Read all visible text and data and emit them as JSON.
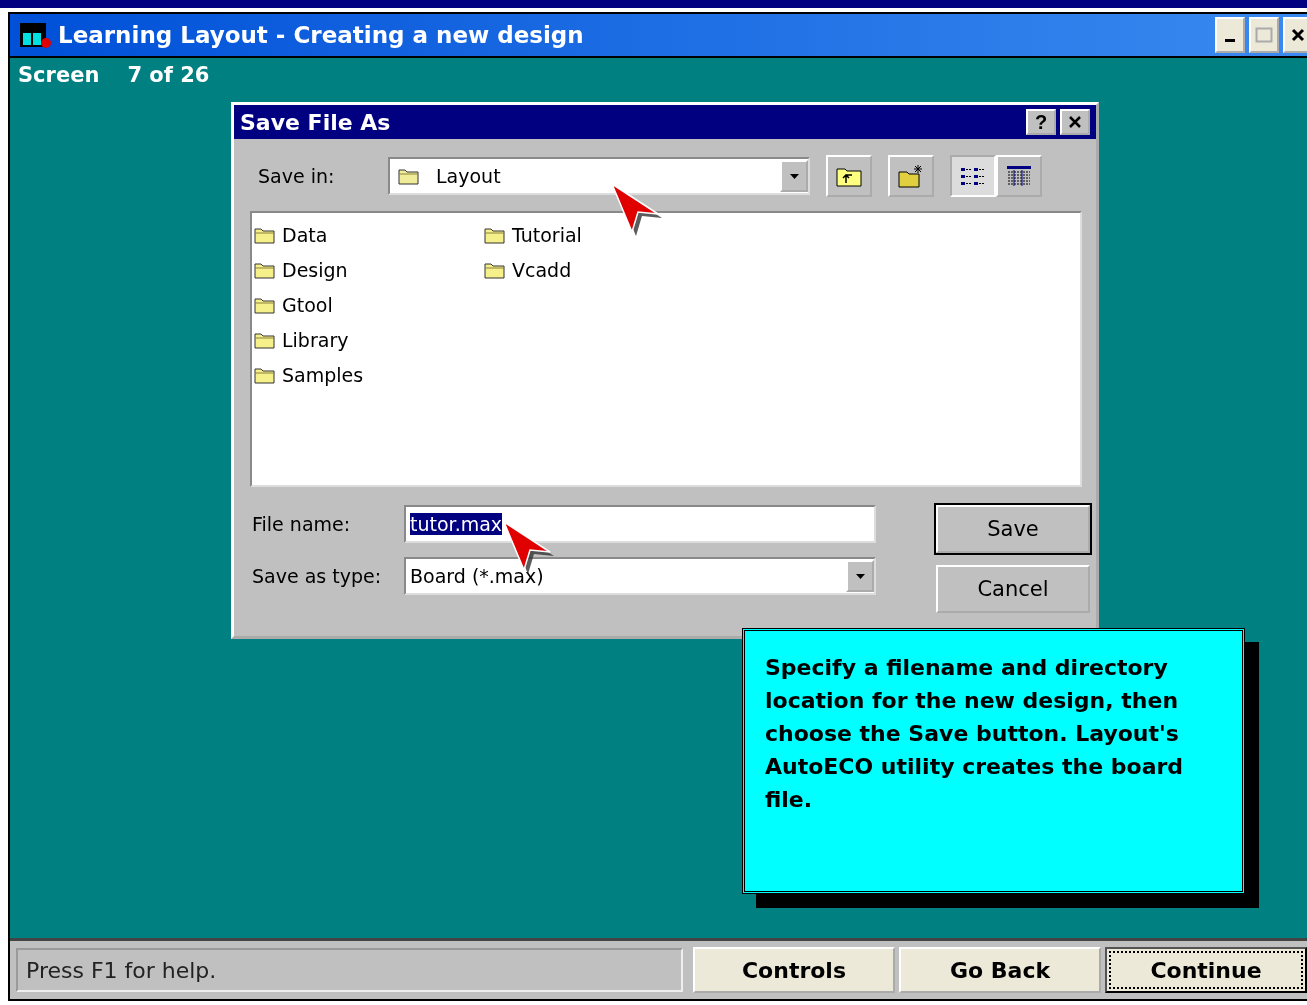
{
  "window": {
    "title": "Learning Layout - Creating a new design",
    "screen_label": "Screen",
    "screen_counter": "7 of 26"
  },
  "dialog": {
    "title": "Save File As",
    "help": "?",
    "save_in_label": "Save in:",
    "save_in_value": "Layout",
    "view_buttons": [
      {
        "kind": "list",
        "selected": true
      },
      {
        "kind": "details",
        "selected": false
      }
    ],
    "folders": [
      {
        "name": "Data"
      },
      {
        "name": "Design"
      },
      {
        "name": "Gtool"
      },
      {
        "name": "Library"
      },
      {
        "name": "Samples"
      },
      {
        "name": "Tutorial"
      },
      {
        "name": "Vcadd"
      }
    ],
    "file_name_label": "File name:",
    "file_name_value": "tutor.max",
    "file_name_selected": true,
    "type_label": "Save as type:",
    "type_value": "Board (*.max)",
    "buttons": [
      {
        "label": "Save",
        "default": true
      },
      {
        "label": "Cancel",
        "default": false
      }
    ]
  },
  "callout": {
    "text": "Specify a filename and directory location for the new design, then choose the Save button. Layout's AutoECO utility creates the board file."
  },
  "status_bar": {
    "text": "Press F1 for help.",
    "buttons": [
      {
        "label": "Controls",
        "default": false
      },
      {
        "label": "Go Back",
        "default": false
      },
      {
        "label": "Continue",
        "default": true
      }
    ]
  }
}
